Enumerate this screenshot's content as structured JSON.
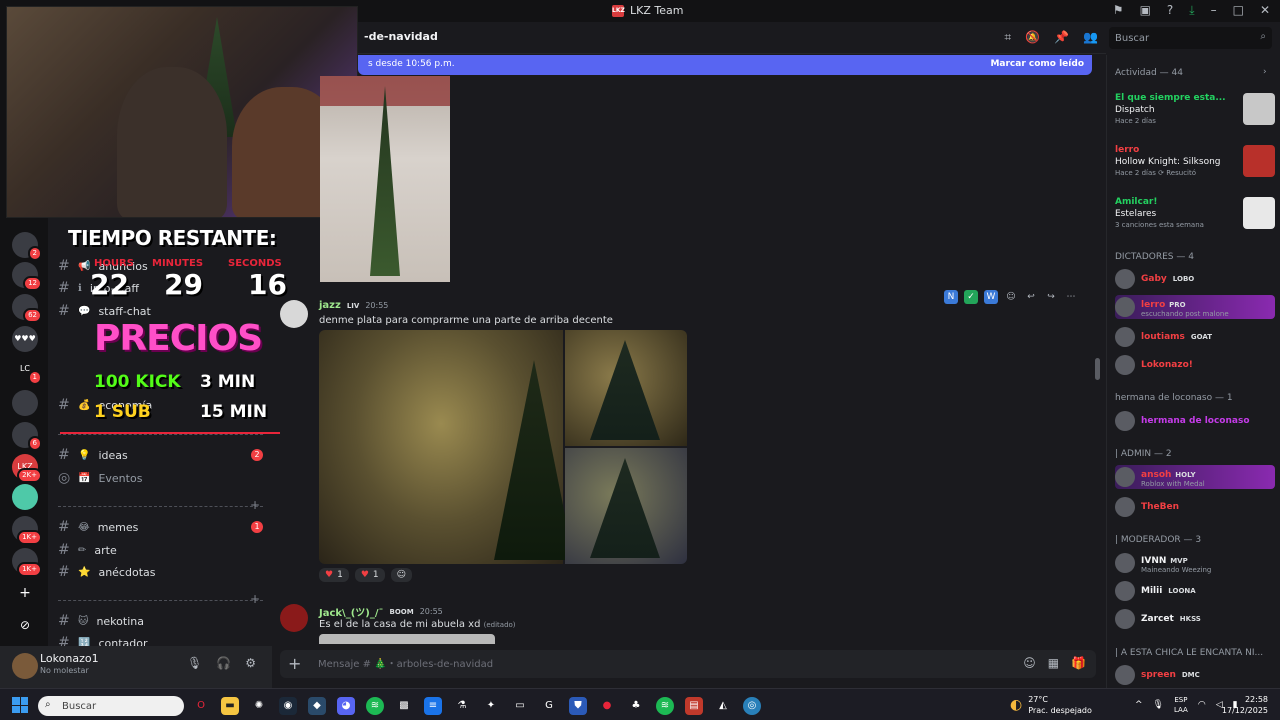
{
  "window": {
    "title": "LKZ Team",
    "logo_text": "LKZ"
  },
  "header": {
    "channel": "-de-navidad"
  },
  "search": {
    "placeholder": "Buscar"
  },
  "new_messages": {
    "since": "s desde 10:56 p.m.",
    "mark_read": "Marcar como leído"
  },
  "overlay": {
    "title": "TIEMPO RESTANTE:",
    "hours_label": "HOURS",
    "minutes_label": "MINUTES",
    "seconds_label": "SECONDS",
    "hours": "22",
    "minutes": "29",
    "seconds": "16",
    "precios": "PRECIOS",
    "kick": "100 KICK",
    "kick_time": "3 MIN",
    "sub": "1 SUB",
    "sub_time": "15 MIN"
  },
  "channels": [
    {
      "name": "anuncios",
      "emoji": "📢"
    },
    {
      "name": "info-staff",
      "emoji": "ℹ"
    },
    {
      "name": "staff-chat",
      "emoji": "💬"
    },
    {
      "name": "economía",
      "emoji": "💰"
    },
    {
      "name": "ideas",
      "emoji": "💡",
      "unread": "2"
    },
    {
      "name": "Eventos",
      "emoji": "📅"
    },
    {
      "name": "memes",
      "emoji": "😂",
      "unread": "1"
    },
    {
      "name": "arte",
      "emoji": "✏"
    },
    {
      "name": "anécdotas",
      "emoji": "⭐"
    },
    {
      "name": "nekotina",
      "emoji": "🐱"
    },
    {
      "name": "contador",
      "emoji": "🔢"
    }
  ],
  "rail_badges": [
    "2",
    "12",
    "62",
    "1",
    "6",
    "2K+",
    "1K+",
    "1K+"
  ],
  "rail_label": "LC",
  "user": {
    "name": "Lokonazo1",
    "status": "No molestar"
  },
  "messages": [
    {
      "user": "jazz",
      "tag": "LIV",
      "time": "20:55",
      "text": "denme plata para comprarme una parte de arriba decente",
      "reactions": [
        {
          "count": "1"
        },
        {
          "count": "1"
        }
      ]
    },
    {
      "user": "Jack\\_(ツ)_/¯",
      "tag": "BOOM",
      "time": "20:55",
      "text": "Es el de la casa de mi abuela xd",
      "edited": "(editado)"
    }
  ],
  "composer": {
    "placeholder": "Mensaje # 🎄・arboles-de-navidad"
  },
  "members": {
    "activity_header": "Actividad — 44",
    "activities": [
      {
        "user": "El que siempre esta...",
        "game": "Dispatch",
        "meta": "Hace 2 días",
        "color": "#23d160"
      },
      {
        "user": "lerro",
        "game": "Hollow Knight: Silksong",
        "meta": "Hace 2 días  ⟳ Resucitó",
        "color": "#f23f43"
      },
      {
        "user": "Amilcar!",
        "game": "Estelares",
        "meta": "3 canciones esta semana",
        "color": "#23d160"
      }
    ],
    "dictadores_header": "DICTADORES — 4",
    "dictadores": [
      {
        "name": "Gaby",
        "badge": "LOBO",
        "color": "#f23f43"
      },
      {
        "name": "lerro",
        "badge": "PRO",
        "status": "escuchando post malone",
        "color": "#f23f43",
        "highlight": true
      },
      {
        "name": "loutiams",
        "badge": "GOAT",
        "color": "#f23f43"
      },
      {
        "name": "Lokonazo!",
        "badge": "",
        "color": "#f23f43"
      }
    ],
    "hermana_header": "hermana de loconaso — 1",
    "hermana": [
      {
        "name": "hermana de loconaso",
        "color": "#c43ce8"
      }
    ],
    "admin_header": "| ADMIN — 2",
    "admins": [
      {
        "name": "ansoh",
        "badge": "HOLY",
        "status": "Roblox with Medal",
        "color": "#f23f43",
        "highlight": true
      },
      {
        "name": "TheBen",
        "badge": "",
        "color": "#f23f43"
      }
    ],
    "mod_header": "| MODERADOR — 3",
    "mods": [
      {
        "name": "IVNN",
        "badge": "MVP",
        "status": "Maineando Weezing",
        "color": "#f2f3f5"
      },
      {
        "name": "Milii",
        "badge": "LOONA",
        "color": "#f2f3f5"
      },
      {
        "name": "Zarcet",
        "badge": "HKSS",
        "color": "#f2f3f5"
      }
    ],
    "chica_header": "| A ESTA CHICA LE ENCANTA NI...",
    "chica": [
      {
        "name": "spreen",
        "badge": "DMC",
        "color": "#f23f43"
      }
    ]
  },
  "taskbar": {
    "search_placeholder": "Buscar",
    "temp": "27°C",
    "weather": "Prac. despejado",
    "lang1": "ESP",
    "lang2": "LAA",
    "time": "22:58",
    "date": "17/12/2025"
  }
}
